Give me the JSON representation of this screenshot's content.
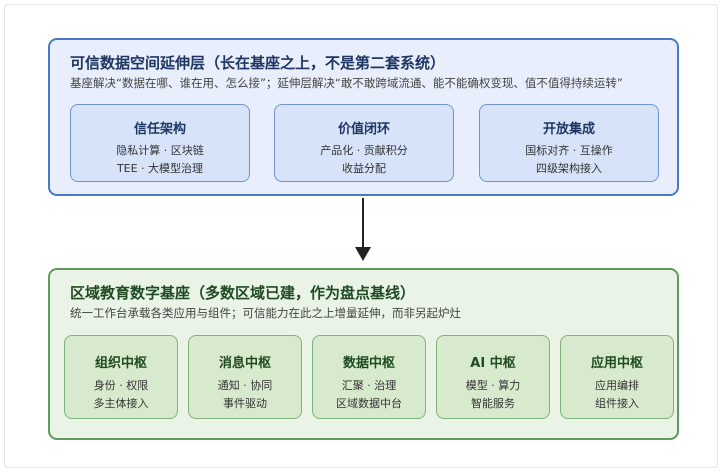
{
  "trust_layer": {
    "title": "可信数据空间延伸层（长在基座之上，不是第二套系统）",
    "subtitle": "基座解决“数据在哪、谁在用、怎么接”；延伸层解决“敢不敢跨域流通、能不能确权变现、值不值得持续运转”",
    "cards": [
      {
        "title": "信任架构",
        "lines": [
          "隐私计算 · 区块链",
          "TEE · 大模型治理"
        ]
      },
      {
        "title": "价值闭环",
        "lines": [
          "产品化 · 贡献积分",
          "收益分配"
        ]
      },
      {
        "title": "开放集成",
        "lines": [
          "国标对齐 · 互操作",
          "四级架构接入"
        ]
      }
    ]
  },
  "base_layer": {
    "title": "区域教育数字基座（多数区域已建，作为盘点基线）",
    "subtitle": "统一工作台承载各类应用与组件；可信能力在此之上增量延伸，而非另起炉灶",
    "cards": [
      {
        "title": "组织中枢",
        "lines": [
          "身份 · 权限",
          "多主体接入"
        ]
      },
      {
        "title": "消息中枢",
        "lines": [
          "通知 · 协同",
          "事件驱动"
        ]
      },
      {
        "title": "数据中枢",
        "lines": [
          "汇聚 · 治理",
          "区域数据中台"
        ]
      },
      {
        "title": "AI 中枢",
        "lines": [
          "模型 · 算力",
          "智能服务"
        ]
      },
      {
        "title": "应用中枢",
        "lines": [
          "应用编排",
          "组件接入"
        ]
      }
    ]
  },
  "colors": {
    "top_border": "#4a78c9",
    "top_fill": "#e8eefb",
    "bottom_border": "#5f9a5c",
    "bottom_fill": "#e9f3e6",
    "arrow": "#222222"
  },
  "connector": {
    "direction": "down",
    "from": "trust_layer",
    "to": "base_layer"
  }
}
